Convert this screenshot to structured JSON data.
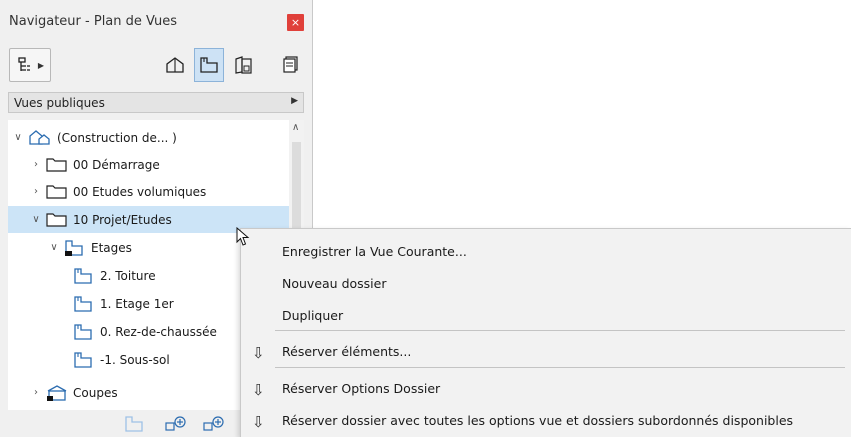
{
  "window": {
    "title": "Navigateur - Plan de Vues",
    "close_label": "×"
  },
  "toolbar": {
    "map_button_icon": "project-map-icon",
    "view_buttons": [
      {
        "icon": "3d-house-icon",
        "active": false
      },
      {
        "icon": "floor-plan-icon",
        "active": true
      },
      {
        "icon": "layout-book-icon",
        "active": false
      },
      {
        "icon": "publisher-sets-icon",
        "active": false
      }
    ]
  },
  "dropdown": {
    "label": "Vues publiques"
  },
  "tree": {
    "items": [
      {
        "label": "(Construction de... )",
        "icon": "project-root-icon",
        "expander": "expanded"
      },
      {
        "label": "00 Démarrage",
        "icon": "folder-icon",
        "expander": "collapsed"
      },
      {
        "label": "00 Etudes volumiques",
        "icon": "folder-icon",
        "expander": "collapsed"
      },
      {
        "label": "10 Projet/Etudes",
        "icon": "folder-icon",
        "expander": "expanded",
        "selected": true
      },
      {
        "label": "Etages",
        "icon": "stories-icon",
        "expander": "expanded"
      },
      {
        "label": "2. Toiture",
        "icon": "floor-plan-icon",
        "expander": "none"
      },
      {
        "label": "1. Etage 1er",
        "icon": "floor-plan-icon",
        "expander": "none"
      },
      {
        "label": "0. Rez-de-chaussée",
        "icon": "floor-plan-icon",
        "expander": "none"
      },
      {
        "label": "-1. Sous-sol",
        "icon": "floor-plan-icon",
        "expander": "none"
      },
      {
        "label": "Coupes",
        "icon": "section-icon",
        "expander": "collapsed"
      }
    ]
  },
  "context_menu": {
    "items": [
      {
        "label": "Enregistrer la Vue Courante...",
        "icon": ""
      },
      {
        "label": "Nouveau dossier",
        "icon": ""
      },
      {
        "label": "Dupliquer",
        "icon": ""
      },
      {
        "label": "Réserver éléments...",
        "icon": "reserve-arrow-icon"
      },
      {
        "label": "Réserver Options Dossier",
        "icon": "reserve-arrow-icon"
      },
      {
        "label": "Réserver dossier avec toutes les options vue et dossiers subordonnés disponibles",
        "icon": "reserve-arrow-icon"
      }
    ],
    "reserve_glyph": "⇩"
  },
  "colors": {
    "selection": "#cce4f7",
    "close_button": "#e0403a",
    "icon_blue": "#2b6cb0",
    "active_button": "#cde2f5"
  }
}
